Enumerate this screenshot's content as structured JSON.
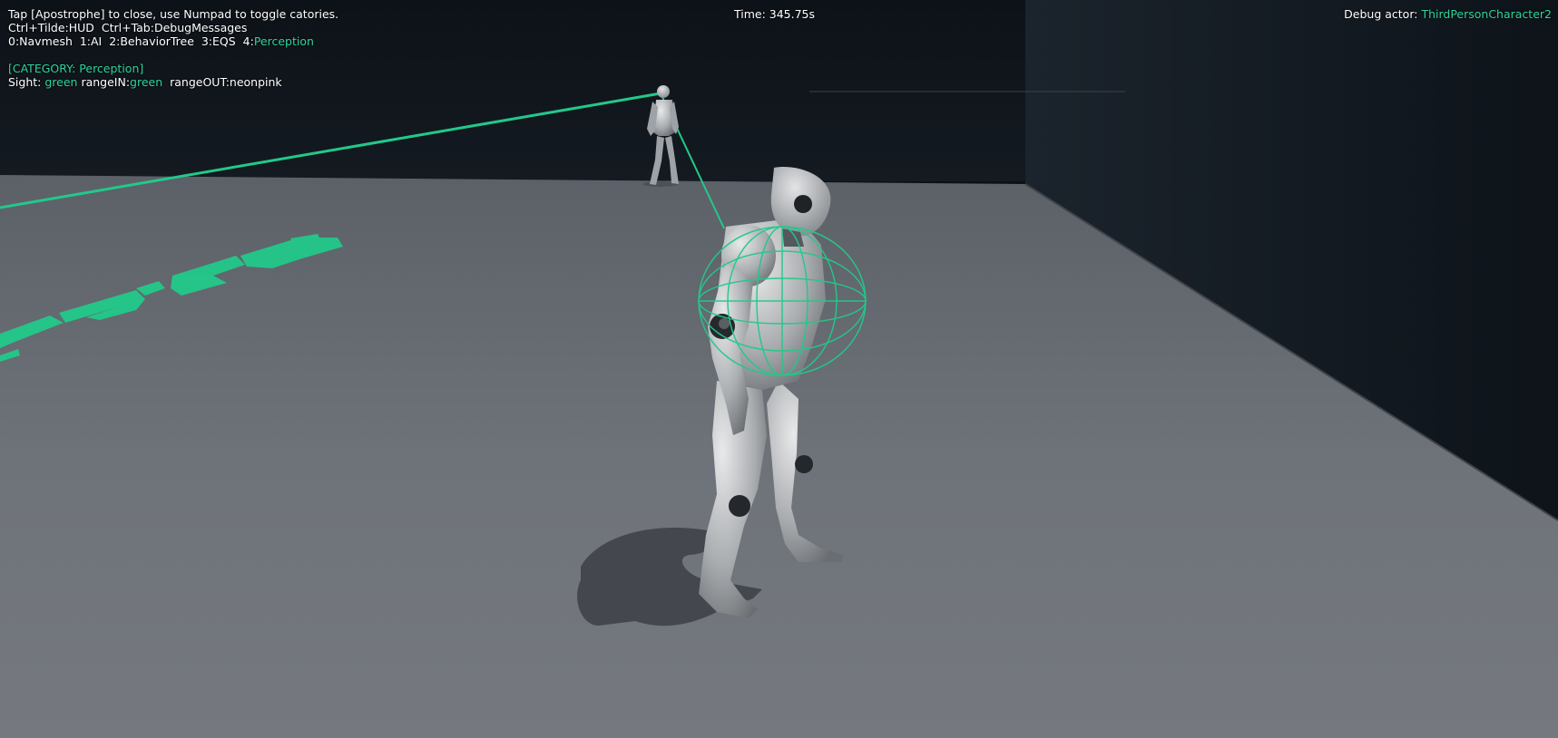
{
  "hud": {
    "line1": "Tap [Apostrophe] to close, use Numpad to toggle catories.",
    "line2": "Ctrl+Tilde:HUD  Ctrl+Tab:DebugMessages",
    "categories": [
      {
        "label": "0:Navmesh  ",
        "active": false
      },
      {
        "label": "1:AI  ",
        "active": false
      },
      {
        "label": "2:BehaviorTree  ",
        "active": false
      },
      {
        "label": "3:EQS  ",
        "active": false
      },
      {
        "label": "4:",
        "active": false
      },
      {
        "label": "Perception",
        "active": true
      }
    ],
    "category_header": "[CATEGORY: Perception]",
    "sight": {
      "label": "Sight: ",
      "color_value": "green",
      "range_in_label": " rangeIN:",
      "range_in_value": "green",
      "range_out_label": "  rangeOUT:",
      "range_out_value": "neonpink"
    },
    "time_label": "Time: 345.75s",
    "debug_actor_label": "Debug actor: ",
    "debug_actor_name": "ThirdPersonCharacter2"
  },
  "colors": {
    "debug_green": "#2fd49a",
    "floor": "#6f7379",
    "wall": "#151b22",
    "sky": "#0c1117"
  },
  "scene": {
    "floor_text": "gameplay text (perspective, partially visible)",
    "player_character": "mannequin",
    "ai_character": "mannequin"
  }
}
